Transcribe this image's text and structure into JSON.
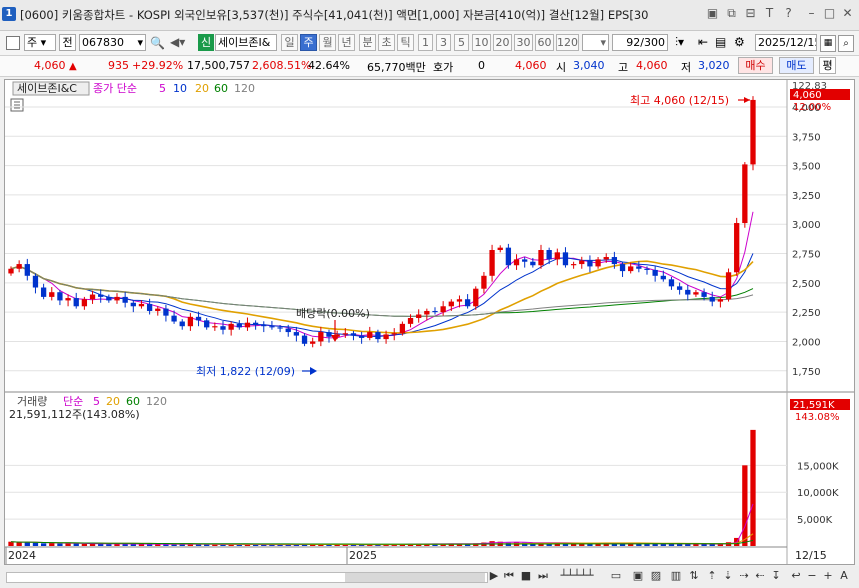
{
  "window": {
    "number": "1",
    "title": "[0600] 키움종합차트 - KOSPI 외국인보유[3,537(천)] 주식수[41,041(천)] 액면[1,000] 자본금[410(억)] 결산[12월] EPS[30"
  },
  "toolbar": {
    "type_select": "주",
    "prev_label": "전",
    "code_value": "067830",
    "credit_badge": "신",
    "stock_name": "세이브존I&",
    "period_tabs": [
      "일",
      "주",
      "월",
      "년",
      "분",
      "초",
      "틱"
    ],
    "active_period": "주",
    "interval_buttons": [
      "1",
      "3",
      "5",
      "10",
      "20",
      "30",
      "60",
      "120"
    ],
    "count_value": "92",
    "count_total": "/300",
    "date_value": "2025/12/15"
  },
  "quote": {
    "price": "4,060",
    "change": "935",
    "change_pct": "+29.92%",
    "volume": "17,500,757",
    "volume_pct": "2,608.51%",
    "turnover_pct": "42.64%",
    "amount": "65,770백만",
    "ask_label": "호가",
    "ask_value": "0",
    "cur_value": "4,060",
    "open_label": "시",
    "open_value": "3,040",
    "high_label": "고",
    "high_value": "4,060",
    "low_label": "저",
    "low_value": "3,020",
    "buy_button": "매수",
    "sell_button": "매도",
    "eval_button": "평"
  },
  "price_panel": {
    "name": "세이브존I&C",
    "ma_label": "종가 단순",
    "ma_periods": [
      "5",
      "10",
      "20",
      "60",
      "120"
    ],
    "ma_colors": [
      "#cc00cc",
      "#0033cc",
      "#e0a000",
      "#008000",
      "#808080"
    ],
    "high_annot": "최고 4,060 (12/15)",
    "low_annot": "최저 1,822 (12/09)",
    "div_annot": "배당락(0.00%)",
    "last_price_tag": "4,060",
    "last_pct_tag": "12.00%",
    "axis_top_label": "122.83"
  },
  "volume_panel": {
    "name": "거래량",
    "ma_label": "단순",
    "ma_periods": [
      "5",
      "20",
      "60",
      "120"
    ],
    "ma_colors": [
      "#cc00cc",
      "#e0a000",
      "#008000",
      "#808080"
    ],
    "current_volume": "21,591,112주(143.08%)",
    "last_volume_tag": "21,591K",
    "last_volume_pct": "143.08%"
  },
  "x_axis": {
    "labels": [
      "2024",
      "2025"
    ],
    "last_date": "12/15"
  },
  "chart_data": {
    "type": "candlestick",
    "price_axis": {
      "ticks": [
        1750,
        2000,
        2250,
        2500,
        2750,
        3000,
        3250,
        3500,
        3750,
        4000
      ],
      "min": 1620,
      "max": 4230
    },
    "volume_axis": {
      "ticks": [
        5000,
        10000,
        15000
      ],
      "unit": "K"
    },
    "weekly_closes": [
      2620,
      2660,
      2560,
      2460,
      2380,
      2420,
      2350,
      2370,
      2300,
      2360,
      2400,
      2380,
      2350,
      2380,
      2330,
      2300,
      2320,
      2260,
      2280,
      2220,
      2170,
      2130,
      2210,
      2180,
      2120,
      2130,
      2100,
      2150,
      2120,
      2160,
      2140,
      2130,
      2120,
      2110,
      2080,
      2050,
      1980,
      2000,
      2080,
      2040,
      2060,
      2070,
      2050,
      2030,
      2080,
      2020,
      2060,
      2070,
      2150,
      2200,
      2230,
      2260,
      2250,
      2300,
      2340,
      2360,
      2300,
      2450,
      2560,
      2780,
      2800,
      2650,
      2700,
      2680,
      2650,
      2780,
      2700,
      2760,
      2650,
      2660,
      2690,
      2640,
      2700,
      2720,
      2660,
      2600,
      2640,
      2620,
      2610,
      2560,
      2530,
      2470,
      2440,
      2400,
      2420,
      2380,
      2340,
      2360,
      2590,
      3010,
      3510,
      4060
    ],
    "weekly_volumes_k": [
      800,
      650,
      700,
      600,
      500,
      550,
      450,
      480,
      500,
      400,
      420,
      380,
      350,
      400,
      380,
      360,
      340,
      320,
      330,
      300,
      320,
      350,
      300,
      280,
      290,
      270,
      300,
      260,
      280,
      250,
      270,
      260,
      250,
      240,
      260,
      300,
      350,
      280,
      260,
      250,
      270,
      260,
      250,
      240,
      260,
      250,
      270,
      300,
      350,
      380,
      400,
      420,
      380,
      400,
      450,
      420,
      380,
      500,
      650,
      900,
      800,
      600,
      650,
      600,
      550,
      650,
      600,
      620,
      550,
      500,
      520,
      480,
      500,
      520,
      480,
      450,
      460,
      440,
      430,
      420,
      410,
      400,
      380,
      370,
      380,
      360,
      340,
      350,
      700,
      1500,
      15000,
      21591
    ]
  }
}
